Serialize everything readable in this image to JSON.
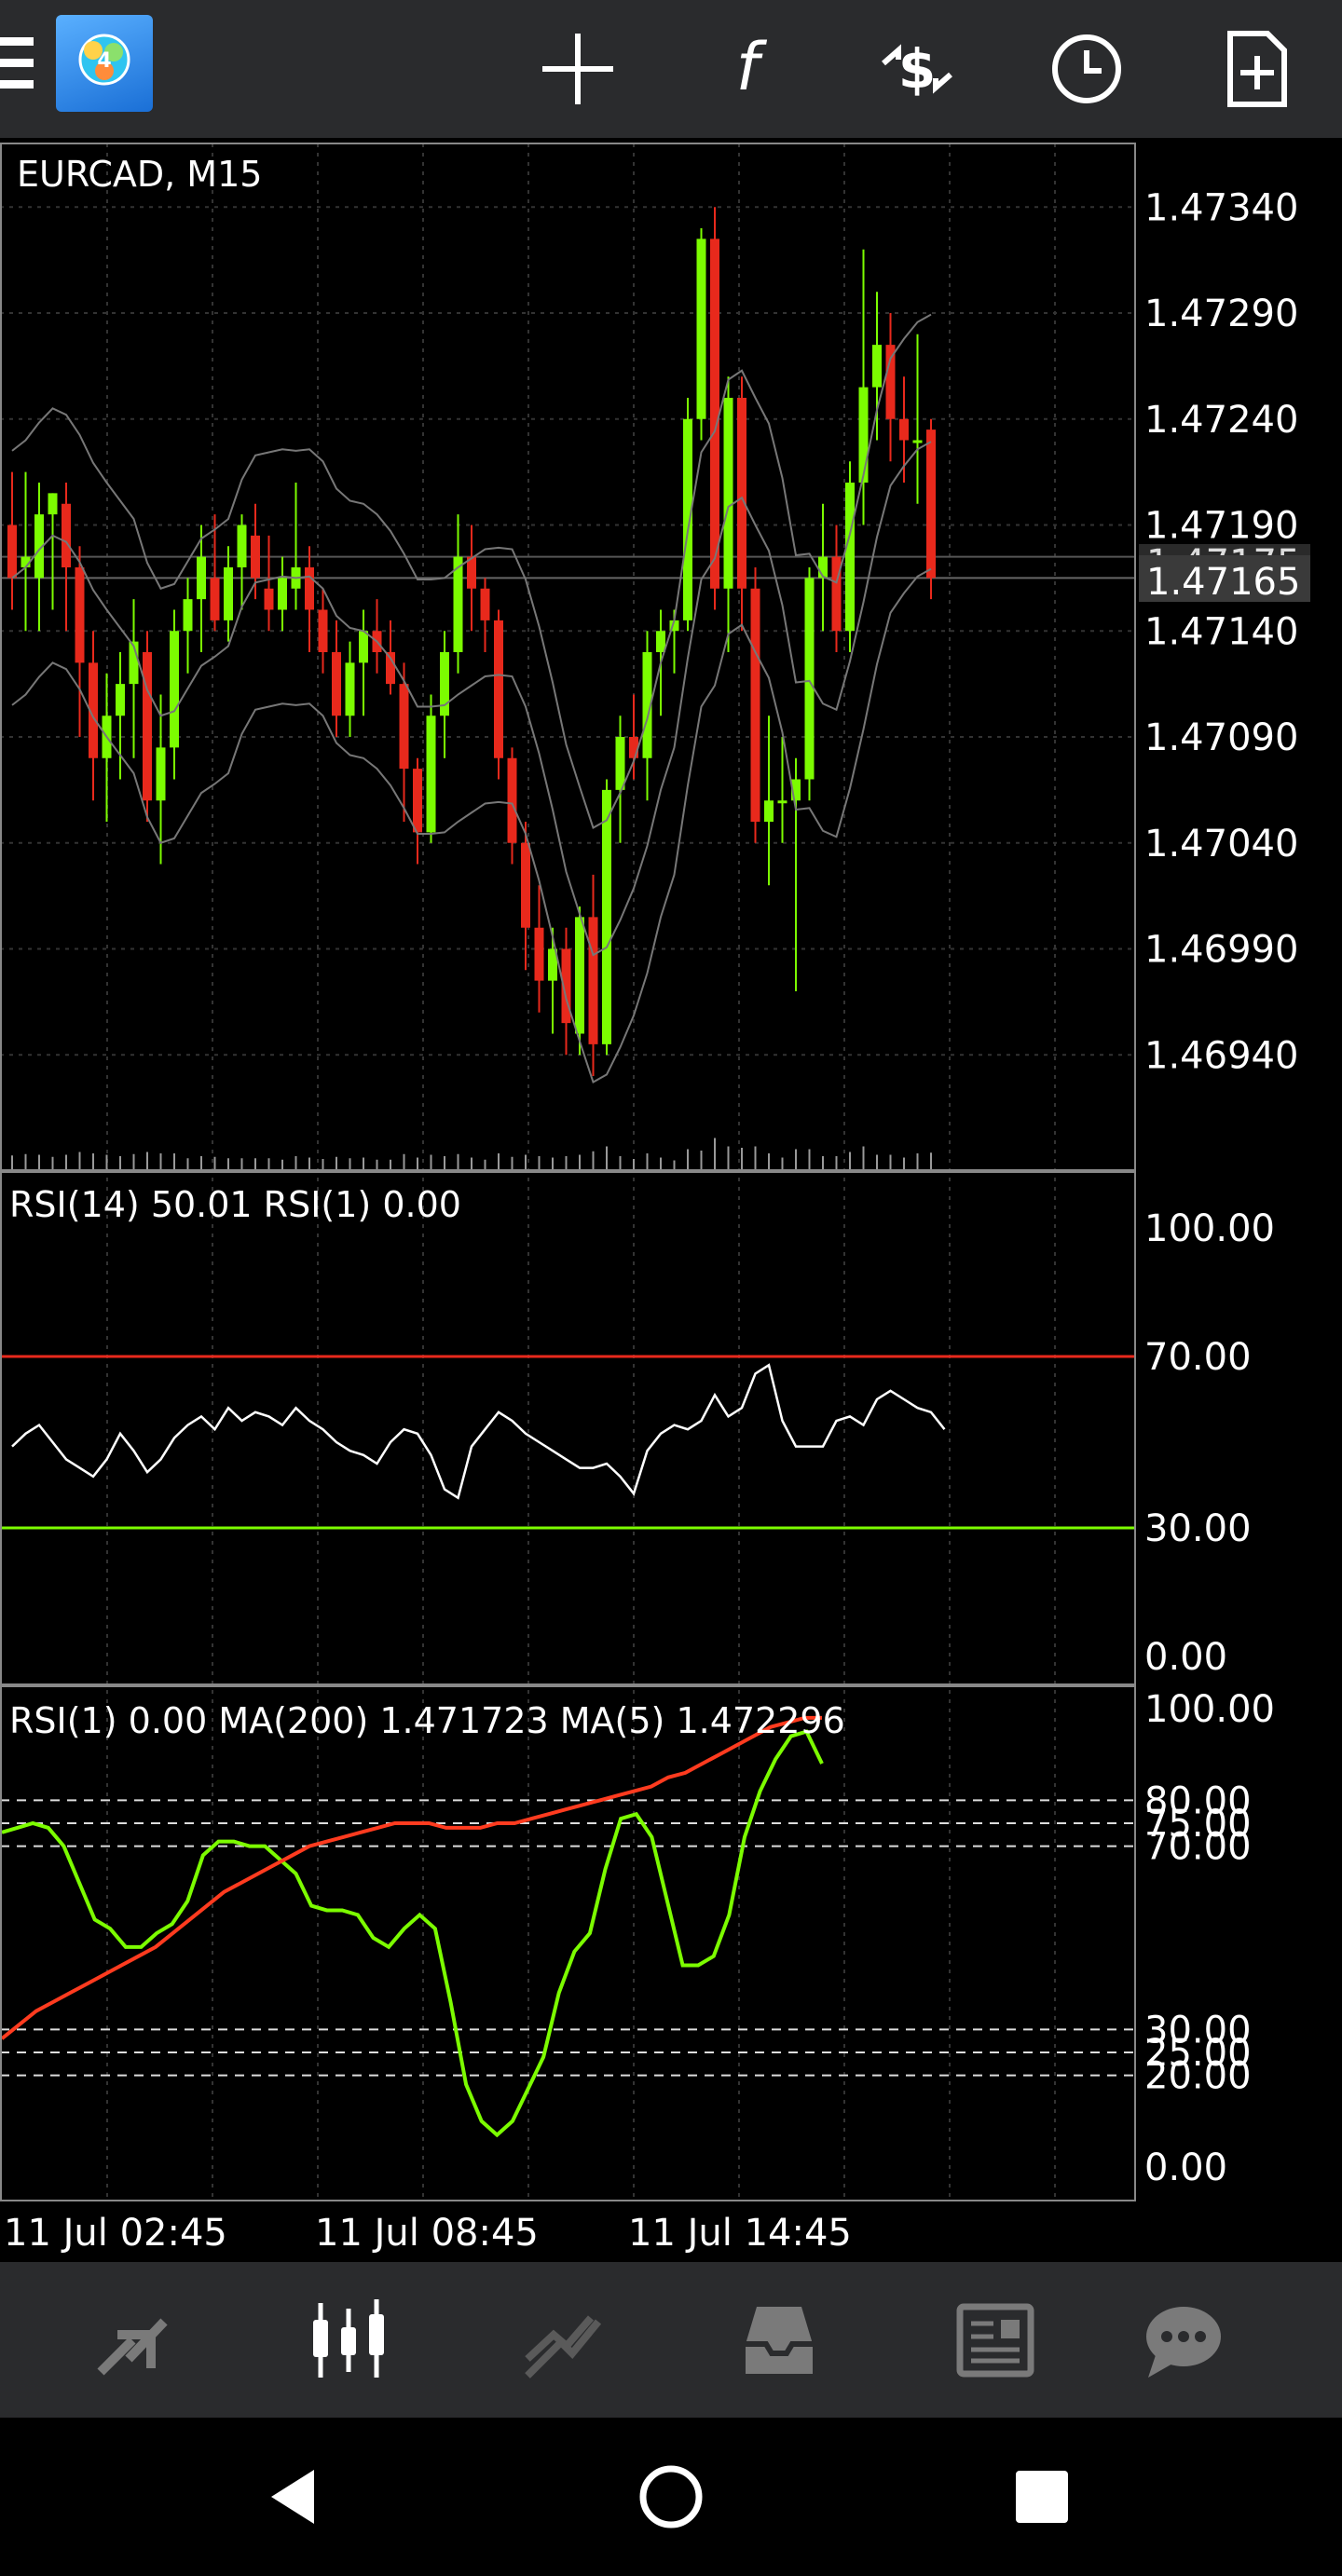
{
  "chart": {
    "symbol_title": "EURCAD, M15",
    "price_ticks": [
      "1.47340",
      "1.47290",
      "1.47240",
      "1.47190",
      "1.47140",
      "1.47090",
      "1.47040",
      "1.46990",
      "1.46940"
    ],
    "price_tag_prev": "1.47175",
    "price_tag_current": "1.47165",
    "rsi_panel_label": "RSI(14) 50.01 RSI(1) 0.00",
    "rsi_ticks": [
      "100.00",
      "70.00",
      "30.00",
      "0.00"
    ],
    "ma_panel_label": "RSI(1) 0.00 MA(200) 1.471723 MA(5) 1.472296",
    "ma_ticks": [
      "100.00",
      "80.00",
      "75.00",
      "70.00",
      "30.00",
      "25.00",
      "20.00",
      "0.00"
    ],
    "time_labels": [
      "11 Jul 02:45",
      "11 Jul 08:45",
      "11 Jul 14:45"
    ]
  },
  "chart_data": [
    {
      "type": "candlestick",
      "title": "EURCAD, M15",
      "ylim": [
        1.4689,
        1.4737
      ],
      "colors": {
        "bull": "#7cfc00",
        "bear": "#e8291c"
      },
      "ohlc": [
        [
          1.4719,
          1.47215,
          1.4715,
          1.47165
        ],
        [
          1.4717,
          1.47215,
          1.4714,
          1.47175
        ],
        [
          1.47165,
          1.4721,
          1.4714,
          1.47195
        ],
        [
          1.47195,
          1.47205,
          1.4715,
          1.47205
        ],
        [
          1.472,
          1.4721,
          1.4714,
          1.4717
        ],
        [
          1.4717,
          1.4718,
          1.4709,
          1.47125
        ],
        [
          1.47125,
          1.4714,
          1.4706,
          1.4708
        ],
        [
          1.4708,
          1.4712,
          1.4705,
          1.471
        ],
        [
          1.471,
          1.4713,
          1.4707,
          1.47115
        ],
        [
          1.47115,
          1.47155,
          1.4708,
          1.47135
        ],
        [
          1.4713,
          1.4714,
          1.4705,
          1.4706
        ],
        [
          1.4706,
          1.4711,
          1.4703,
          1.47085
        ],
        [
          1.47085,
          1.4715,
          1.4707,
          1.4714
        ],
        [
          1.4714,
          1.47165,
          1.4712,
          1.47155
        ],
        [
          1.47155,
          1.4719,
          1.4713,
          1.47175
        ],
        [
          1.47165,
          1.47195,
          1.4714,
          1.47145
        ],
        [
          1.47145,
          1.4718,
          1.47135,
          1.4717
        ],
        [
          1.4717,
          1.47195,
          1.4715,
          1.4719
        ],
        [
          1.47185,
          1.472,
          1.47155,
          1.47165
        ],
        [
          1.4716,
          1.47185,
          1.4714,
          1.4715
        ],
        [
          1.4715,
          1.47175,
          1.4714,
          1.47165
        ],
        [
          1.4716,
          1.4721,
          1.4715,
          1.4717
        ],
        [
          1.4717,
          1.4718,
          1.4713,
          1.4715
        ],
        [
          1.4715,
          1.4716,
          1.4712,
          1.4713
        ],
        [
          1.4713,
          1.47145,
          1.4709,
          1.471
        ],
        [
          1.471,
          1.47135,
          1.4709,
          1.47125
        ],
        [
          1.47125,
          1.4715,
          1.471,
          1.4714
        ],
        [
          1.4714,
          1.47155,
          1.4712,
          1.4713
        ],
        [
          1.4713,
          1.47145,
          1.4711,
          1.47115
        ],
        [
          1.47115,
          1.47125,
          1.4705,
          1.47075
        ],
        [
          1.47075,
          1.4708,
          1.4703,
          1.47045
        ],
        [
          1.47045,
          1.4711,
          1.4704,
          1.471
        ],
        [
          1.471,
          1.4714,
          1.4708,
          1.4713
        ],
        [
          1.4713,
          1.47195,
          1.4712,
          1.47175
        ],
        [
          1.47175,
          1.4719,
          1.4714,
          1.4716
        ],
        [
          1.4716,
          1.47165,
          1.4713,
          1.47145
        ],
        [
          1.47145,
          1.4715,
          1.4707,
          1.4708
        ],
        [
          1.4708,
          1.47085,
          1.4703,
          1.4704
        ],
        [
          1.4704,
          1.4705,
          1.4698,
          1.47
        ],
        [
          1.47,
          1.4702,
          1.4696,
          1.46975
        ],
        [
          1.46975,
          1.47,
          1.4695,
          1.4699
        ],
        [
          1.4699,
          1.47,
          1.4694,
          1.46955
        ],
        [
          1.4695,
          1.4701,
          1.4694,
          1.47005
        ],
        [
          1.47005,
          1.47025,
          1.4693,
          1.46945
        ],
        [
          1.46945,
          1.4707,
          1.4694,
          1.47065
        ],
        [
          1.47065,
          1.471,
          1.4704,
          1.4709
        ],
        [
          1.4709,
          1.4711,
          1.4707,
          1.4708
        ],
        [
          1.4708,
          1.4714,
          1.4706,
          1.4713
        ],
        [
          1.4713,
          1.4715,
          1.471,
          1.4714
        ],
        [
          1.4714,
          1.4715,
          1.4712,
          1.47145
        ],
        [
          1.47145,
          1.4725,
          1.4714,
          1.4724
        ],
        [
          1.4724,
          1.4733,
          1.4723,
          1.47325
        ],
        [
          1.47325,
          1.4734,
          1.4715,
          1.4716
        ],
        [
          1.4716,
          1.4726,
          1.4713,
          1.4725
        ],
        [
          1.4725,
          1.4726,
          1.4714,
          1.4716
        ],
        [
          1.4716,
          1.4717,
          1.4704,
          1.4705
        ],
        [
          1.4705,
          1.471,
          1.4702,
          1.4706
        ],
        [
          1.4706,
          1.4709,
          1.4704,
          1.4706
        ],
        [
          1.4706,
          1.4708,
          1.4697,
          1.4707
        ],
        [
          1.4707,
          1.4717,
          1.4706,
          1.47165
        ],
        [
          1.47165,
          1.472,
          1.4714,
          1.47175
        ],
        [
          1.47175,
          1.4719,
          1.4713,
          1.4714
        ],
        [
          1.4714,
          1.4722,
          1.4713,
          1.4721
        ],
        [
          1.4721,
          1.4732,
          1.4719,
          1.47255
        ],
        [
          1.47255,
          1.473,
          1.4723,
          1.47275
        ],
        [
          1.47275,
          1.4729,
          1.4722,
          1.4724
        ],
        [
          1.4724,
          1.4726,
          1.4721,
          1.4723
        ],
        [
          1.4723,
          1.4728,
          1.472,
          1.4723
        ],
        [
          1.47235,
          1.4724,
          1.47155,
          1.47165
        ]
      ]
    },
    {
      "type": "line",
      "title": "RSI(14) 50.01 RSI(1) 0.00",
      "ylim": [
        0,
        100
      ],
      "levels": [
        70,
        30
      ],
      "series": [
        {
          "values": [
            49,
            52,
            54,
            50,
            46,
            44,
            42,
            46,
            52,
            48,
            43,
            46,
            51,
            54,
            56,
            53,
            58,
            55,
            57,
            56,
            54,
            58,
            55,
            53,
            50,
            48,
            47,
            45,
            50,
            53,
            52,
            47,
            39,
            37,
            49,
            53,
            57,
            55,
            52,
            50,
            48,
            46,
            44,
            44,
            45,
            42,
            38,
            48,
            52,
            54,
            53,
            55,
            61,
            56,
            58,
            66,
            68,
            55,
            49,
            49,
            49,
            55,
            56,
            54,
            60,
            62,
            60,
            58,
            57,
            53
          ]
        }
      ]
    },
    {
      "type": "line",
      "title": "RSI(1) 0.00 MA(200) 1.471723 MA(5) 1.472296",
      "ylim": [
        0,
        100
      ],
      "levels": [
        80,
        75,
        70,
        30,
        25,
        20
      ],
      "series": [
        {
          "name": "RSI(1)",
          "color": "#7cfc00",
          "values": [
            73,
            74,
            75,
            74,
            70,
            62,
            54,
            52,
            48,
            48,
            51,
            53,
            58,
            68,
            71,
            71,
            70,
            70,
            67,
            64,
            57,
            56,
            56,
            55,
            50,
            48,
            52,
            55,
            52,
            36,
            18,
            10,
            7,
            10,
            17,
            24,
            38,
            47,
            51,
            65,
            76,
            77,
            72,
            58,
            44,
            44,
            46,
            55,
            72,
            82,
            89,
            94,
            95,
            88
          ]
        },
        {
          "name": "MA",
          "color": "#ff3b1f",
          "values": [
            28,
            31,
            34,
            36,
            38,
            40,
            42,
            44,
            46,
            48,
            51,
            54,
            57,
            60,
            62,
            64,
            66,
            68,
            70,
            71,
            72,
            73,
            74,
            75,
            75,
            75,
            74,
            74,
            74,
            75,
            75,
            76,
            77,
            78,
            79,
            80,
            81,
            82,
            83,
            85,
            86,
            88,
            90,
            92,
            94,
            96,
            97,
            98,
            98
          ]
        }
      ]
    }
  ],
  "toolbar": {
    "icons": [
      "menu-icon",
      "app-logo",
      "crosshair-icon",
      "function-icon",
      "trade-icon",
      "clock-icon",
      "new-document-icon"
    ]
  },
  "tabbar": {
    "tabs": [
      "quotes-icon",
      "chart-icon",
      "trade-icon",
      "history-icon",
      "news-icon",
      "chat-icon"
    ],
    "active_tab": "chart-icon"
  },
  "navbar": {
    "buttons": [
      "back-icon",
      "home-icon",
      "recents-icon"
    ]
  }
}
